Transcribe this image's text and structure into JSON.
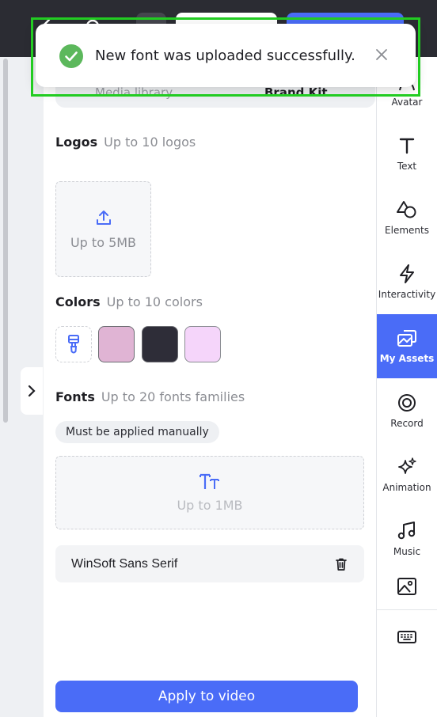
{
  "toast": {
    "message": "New font was uploaded successfully."
  },
  "tabs": {
    "media_library": "Media library",
    "brand_kit": "Brand Kit"
  },
  "logos": {
    "title": "Logos",
    "subtitle": "Up to 10 logos",
    "upload_label": "Up to 5MB"
  },
  "colors": {
    "title": "Colors",
    "subtitle": "Up to 10 colors",
    "swatches": [
      "#e0b4d4",
      "#2e2d38",
      "#f5d5fa"
    ]
  },
  "fonts": {
    "title": "Fonts",
    "subtitle": "Up to 20 fonts families",
    "note": "Must be applied manually",
    "upload_label": "Up to 1MB",
    "items": [
      {
        "name": "WinSoft Sans Serif"
      }
    ]
  },
  "apply_button": "Apply to video",
  "rail": {
    "items": [
      {
        "label": "Avatar",
        "icon": "avatar-icon"
      },
      {
        "label": "Text",
        "icon": "text-icon"
      },
      {
        "label": "Elements",
        "icon": "elements-icon"
      },
      {
        "label": "Interactivity",
        "icon": "bolt-icon"
      },
      {
        "label": "My Assets",
        "icon": "assets-icon",
        "active": true
      },
      {
        "label": "Record",
        "icon": "record-icon"
      },
      {
        "label": "Animation",
        "icon": "sparkle-icon"
      },
      {
        "label": "Music",
        "icon": "music-icon"
      },
      {
        "label": "",
        "icon": "image-icon"
      },
      {
        "label": "",
        "icon": "keyboard-icon"
      }
    ]
  },
  "accent_color": "#4a6cf7",
  "success_color": "#5cb85c"
}
